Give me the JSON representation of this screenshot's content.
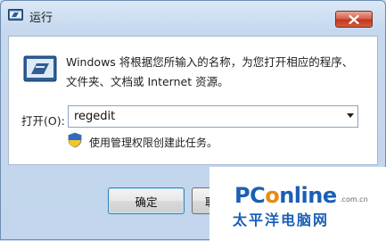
{
  "window": {
    "title": "运行",
    "close_icon": "close-x-icon"
  },
  "dialog": {
    "run_icon": "run-program-icon",
    "description_line1": "Windows 将根据您所输入的名称，为您打开相应的程序、",
    "description_line2": "文件夹、文档或 Internet 资源。",
    "open_label": "打开(O):",
    "open_value": "regedit",
    "shield_icon": "uac-shield-icon",
    "admin_note": "使用管理权限创建此任务。"
  },
  "buttons": {
    "ok_label": "确定",
    "cancel_label": "取"
  },
  "watermark": {
    "logo_pc": "PC",
    "logo_o": "o",
    "logo_rest": "nline",
    "domain": ".com.cn",
    "chinese": "太平洋电脑网"
  },
  "colors": {
    "close_button": "#c2361f",
    "brand_blue": "#1a5fb5",
    "brand_orange": "#e98a12"
  }
}
